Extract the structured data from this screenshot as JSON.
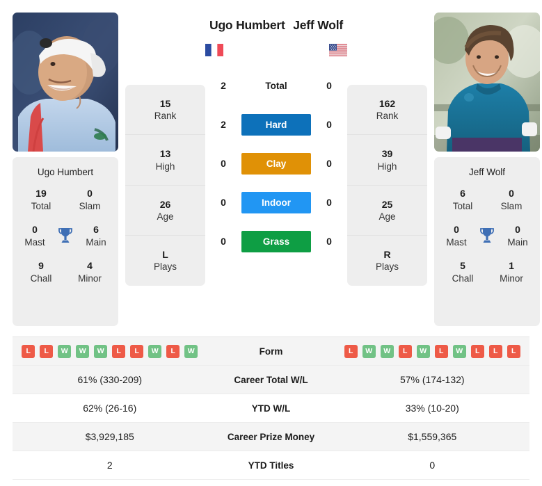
{
  "players": {
    "left": {
      "name": "Ugo Humbert",
      "country_flag": "france-flag",
      "panel_name": "Ugo Humbert",
      "titles": [
        {
          "value": "19",
          "label": "Total"
        },
        {
          "value": "0",
          "label": "Slam"
        },
        {
          "value": "0",
          "label": "Mast"
        },
        {
          "value": "6",
          "label": "Main"
        },
        {
          "value": "9",
          "label": "Chall"
        },
        {
          "value": "4",
          "label": "Minor"
        }
      ],
      "profile": [
        {
          "value": "15",
          "label": "Rank"
        },
        {
          "value": "13",
          "label": "High"
        },
        {
          "value": "26",
          "label": "Age"
        },
        {
          "value": "L",
          "label": "Plays"
        }
      ],
      "form": [
        "L",
        "L",
        "W",
        "W",
        "W",
        "L",
        "L",
        "W",
        "L",
        "W"
      ],
      "career_total_wl": "61% (330-209)",
      "ytd_wl": "62% (26-16)",
      "career_prize_money": "$3,929,185",
      "ytd_titles": "2"
    },
    "right": {
      "name": "Jeff Wolf",
      "country_flag": "usa-flag",
      "panel_name": "Jeff Wolf",
      "titles": [
        {
          "value": "6",
          "label": "Total"
        },
        {
          "value": "0",
          "label": "Slam"
        },
        {
          "value": "0",
          "label": "Mast"
        },
        {
          "value": "0",
          "label": "Main"
        },
        {
          "value": "5",
          "label": "Chall"
        },
        {
          "value": "1",
          "label": "Minor"
        }
      ],
      "profile": [
        {
          "value": "162",
          "label": "Rank"
        },
        {
          "value": "39",
          "label": "High"
        },
        {
          "value": "25",
          "label": "Age"
        },
        {
          "value": "R",
          "label": "Plays"
        }
      ],
      "form": [
        "L",
        "W",
        "W",
        "L",
        "W",
        "L",
        "W",
        "L",
        "L",
        "L"
      ],
      "career_total_wl": "57% (174-132)",
      "ytd_wl": "33% (10-20)",
      "career_prize_money": "$1,559,365",
      "ytd_titles": "0"
    }
  },
  "h2h": [
    {
      "label": "Total",
      "left": "2",
      "right": "0",
      "badge": false,
      "color": ""
    },
    {
      "label": "Hard",
      "left": "2",
      "right": "0",
      "badge": true,
      "color": "#0d71ba"
    },
    {
      "label": "Clay",
      "left": "0",
      "right": "0",
      "badge": true,
      "color": "#e09106"
    },
    {
      "label": "Indoor",
      "left": "0",
      "right": "0",
      "badge": true,
      "color": "#2196f3"
    },
    {
      "label": "Grass",
      "left": "0",
      "right": "0",
      "badge": true,
      "color": "#0e9e44"
    }
  ],
  "table_rows": [
    {
      "label": "Form",
      "type": "form"
    },
    {
      "label": "Career Total W/L",
      "type": "text",
      "key": "career_total_wl"
    },
    {
      "label": "YTD W/L",
      "type": "text",
      "key": "ytd_wl"
    },
    {
      "label": "Career Prize Money",
      "type": "text",
      "key": "career_prize_money"
    },
    {
      "label": "YTD Titles",
      "type": "text",
      "key": "ytd_titles"
    }
  ],
  "colors": {
    "win_badge": "#71c285",
    "loss_badge": "#ee5a47",
    "trophy": "#3f6fb5",
    "panel_bg": "#eeeeee",
    "row_shade": "#f4f4f4"
  }
}
